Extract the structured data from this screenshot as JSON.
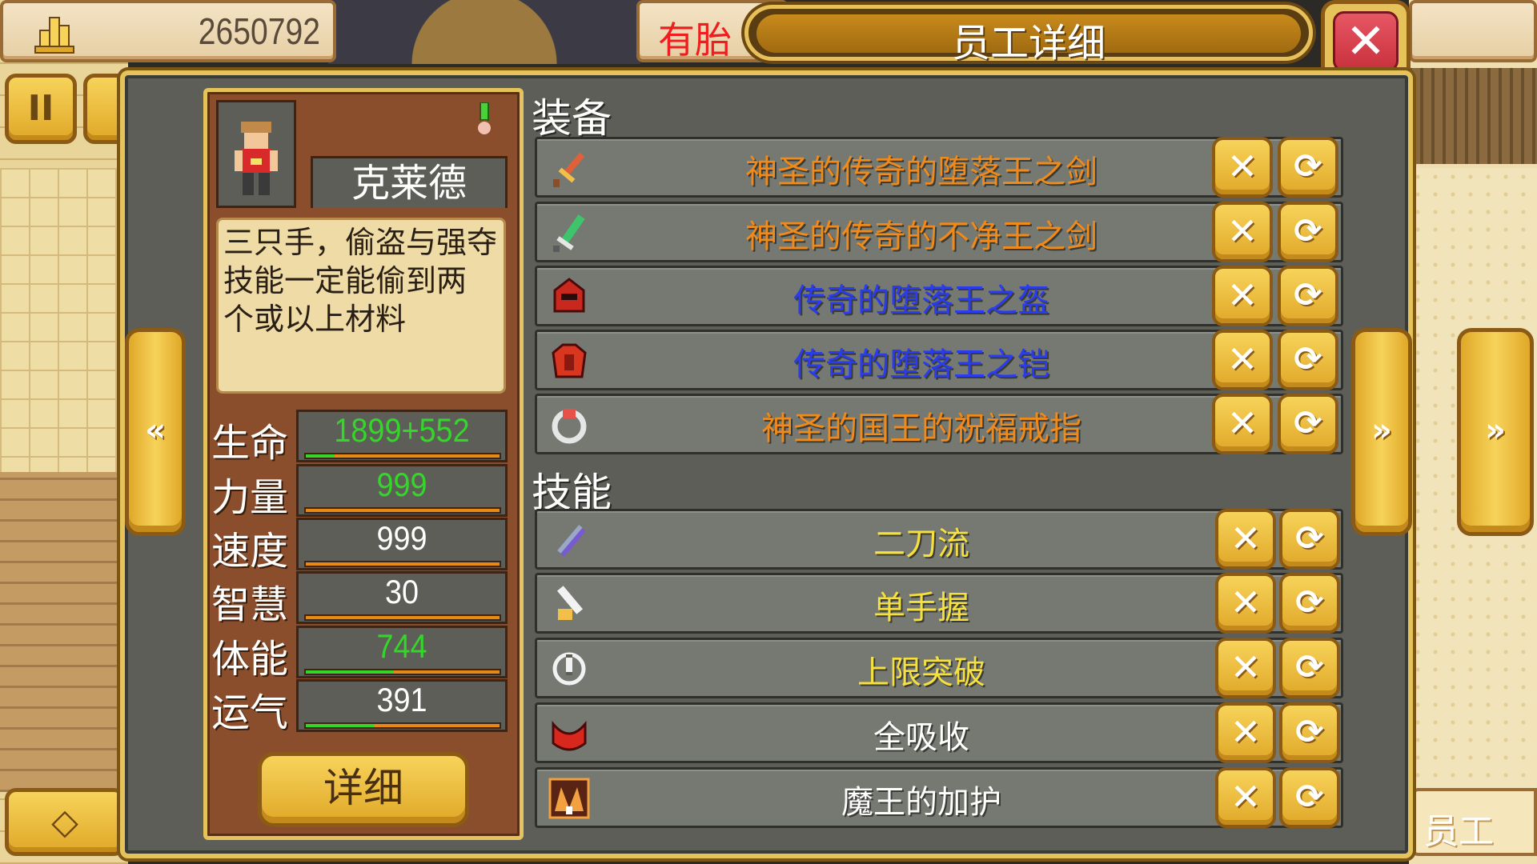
{
  "hud": {
    "money": "2650792",
    "title_left": "有胎",
    "panel_title": "员工详细",
    "close_glyph": "✕",
    "bottom_right_label": "员工"
  },
  "character": {
    "name": "克莱德",
    "description": "三只手，偷盗与强夺\n技能一定能偷到两\n个或以上材料",
    "detail_button": "详细",
    "stats": [
      {
        "label": "生命",
        "value": "1899+552",
        "color": "#35d62a",
        "fill": 0.15
      },
      {
        "label": "力量",
        "value": "999",
        "color": "#35d62a",
        "fill": 0.0
      },
      {
        "label": "速度",
        "value": "999",
        "color": "#ffffff",
        "fill": 0.0
      },
      {
        "label": "智慧",
        "value": "30",
        "color": "#ffffff",
        "fill": 0.0
      },
      {
        "label": "体能",
        "value": "744",
        "color": "#35d62a",
        "fill": 0.45
      },
      {
        "label": "运气",
        "value": "391",
        "color": "#ffffff",
        "fill": 0.35
      }
    ]
  },
  "equipment": {
    "title": "装备",
    "items": [
      {
        "name": "神圣的传奇的堕落王之剑",
        "color": "#f08a1a",
        "icon": "sword-icon"
      },
      {
        "name": "神圣的传奇的不净王之剑",
        "color": "#f08a1a",
        "icon": "green-sword-icon"
      },
      {
        "name": "传奇的堕落王之盔",
        "color": "#2a3cf0",
        "icon": "helmet-icon"
      },
      {
        "name": "传奇的堕落王之铠",
        "color": "#2a3cf0",
        "icon": "armor-icon"
      },
      {
        "name": "神圣的国王的祝福戒指",
        "color": "#f08a1a",
        "icon": "ring-icon"
      }
    ]
  },
  "skills": {
    "title": "技能",
    "items": [
      {
        "name": "二刀流",
        "color": "#f5e040",
        "icon": "dual-blade-icon"
      },
      {
        "name": "单手握",
        "color": "#f5e040",
        "icon": "one-hand-grip-icon"
      },
      {
        "name": "上限突破",
        "color": "#f5e040",
        "icon": "limit-break-icon"
      },
      {
        "name": "全吸收",
        "color": "#ffffff",
        "icon": "absorb-icon"
      },
      {
        "name": "魔王的加护",
        "color": "#ffffff",
        "icon": "demon-king-blessing-icon"
      }
    ]
  },
  "buttons": {
    "remove_glyph": "✕",
    "swap_glyph": "⟳",
    "pause_glyph": "II",
    "prev_glyph": "«",
    "next_glyph": "»",
    "map_glyph": "◇"
  }
}
